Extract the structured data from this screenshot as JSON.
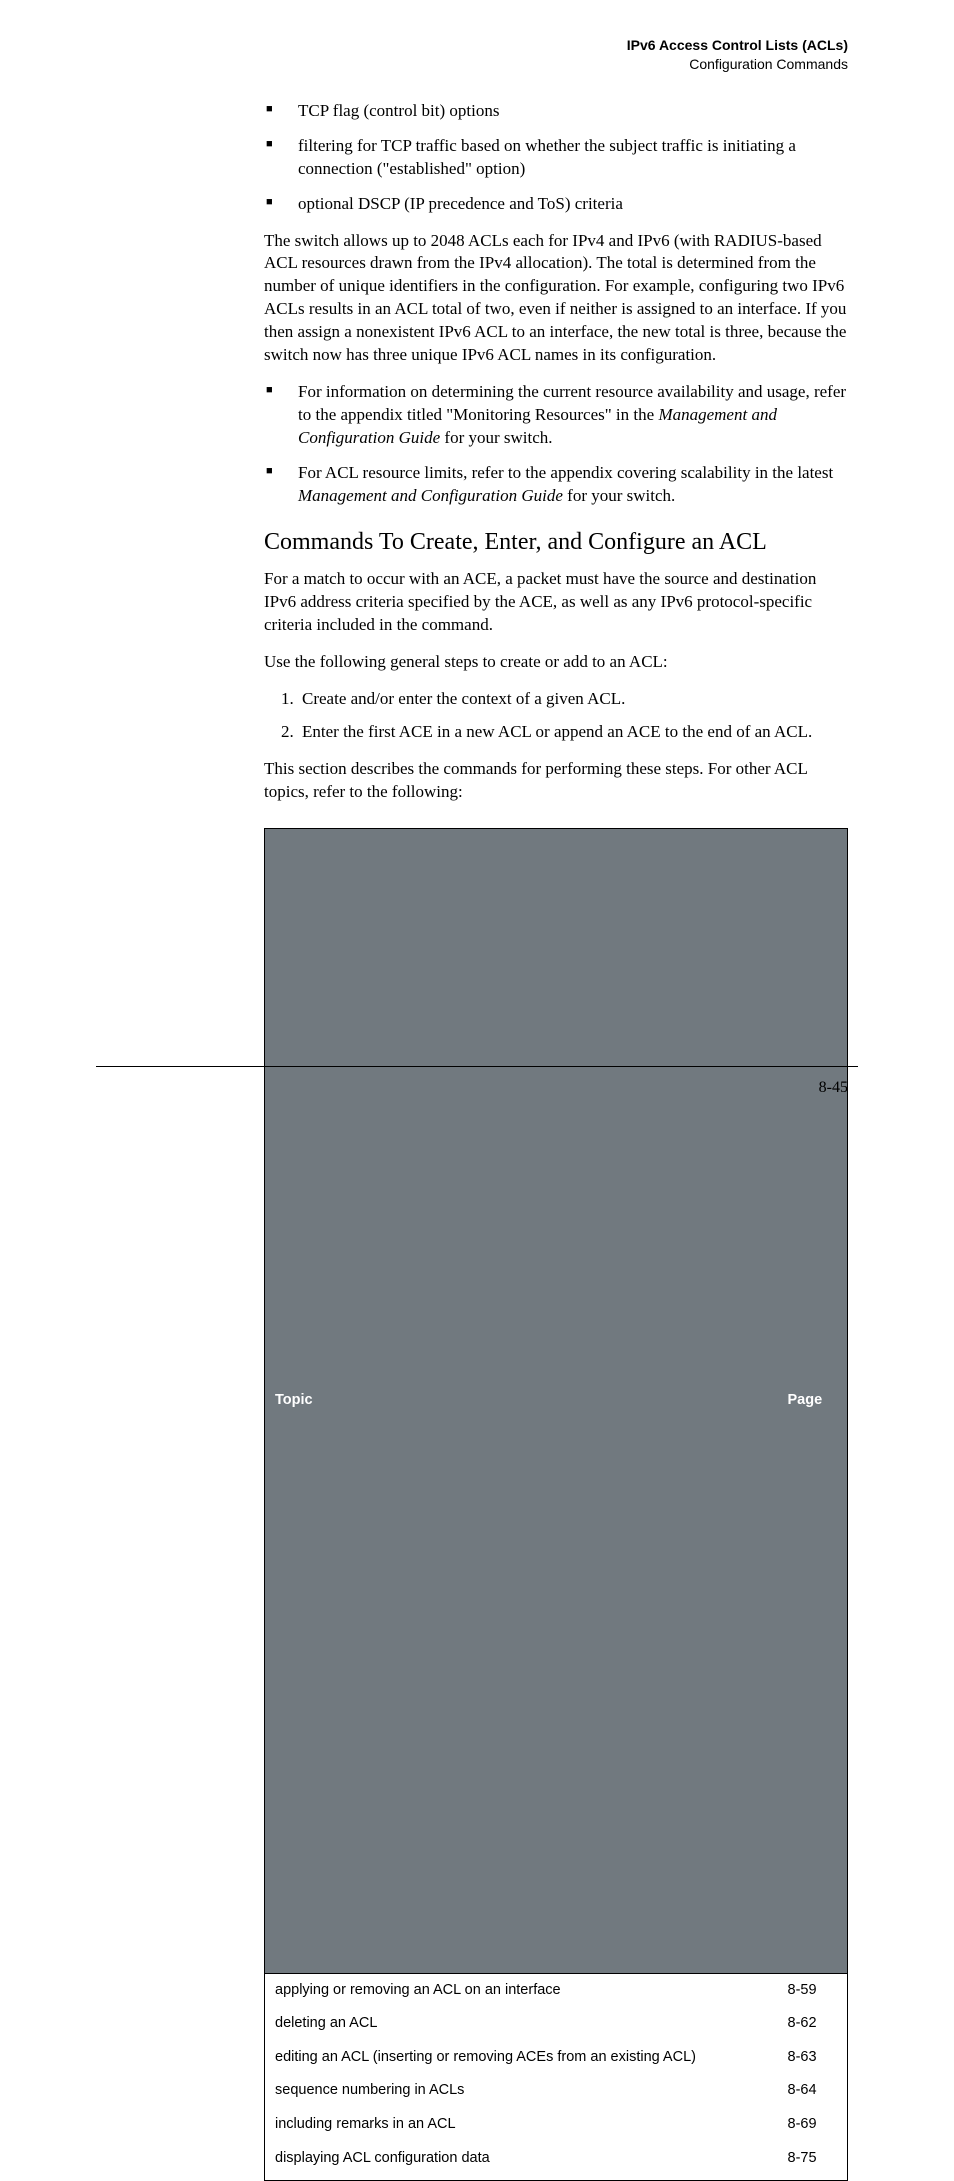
{
  "header": {
    "title": "IPv6 Access Control Lists (ACLs)",
    "subtitle": "Configuration Commands"
  },
  "bullets_top": [
    "TCP flag (control bit) options",
    "filtering for TCP traffic based on whether the subject traffic is initi­ating a connection (\"established\" option)",
    "optional DSCP (IP precedence and ToS) criteria"
  ],
  "para_switch": "The switch allows up to 2048 ACLs each for IPv4 and IPv6 (with RADIUS-based ACL resources drawn from the IPv4 allocation). The total is determined from the number of unique identifiers in the configuration. For example, configuring two IPv6 ACLs results in an ACL total of two, even if neither is assigned to an interface. If you then assign a nonexistent IPv6 ACL to an interface, the new total is three, because the switch now has three unique IPv6 ACL names in its configuration.",
  "bullets_info": {
    "b1_pre": "For information on determining the current resource availability and usage, refer to the appendix titled \"Monitoring Resources\" in the ",
    "b1_ital": "Management and Configuration Guide",
    "b1_post": " for your switch.",
    "b2_pre": "For ACL resource limits, refer to the appendix covering scalability in the latest ",
    "b2_ital": "Management and Configuration Guide",
    "b2_post": " for your switch."
  },
  "section_heading": "Commands To Create, Enter, and Configure an ACL",
  "para_match": "For a match to occur with an ACE, a packet must have the source and destination IPv6 address criteria specified by the ACE, as well as any IPv6 protocol-specific criteria included in the command.",
  "para_steps": "Use the following general steps to create or add to an ACL:",
  "steps": [
    "Create and/or enter the context of a given ACL.",
    "Enter the first ACE in a new ACL or append an ACE to the end of an ACL."
  ],
  "para_section_desc": "This section describes the commands for performing these steps. For other ACL topics, refer to the following:",
  "table": {
    "head_topic": "Topic",
    "head_page": "Page",
    "rows": [
      {
        "topic": "applying or removing an ACL on an interface",
        "page": "8-59"
      },
      {
        "topic": "deleting an ACL",
        "page": "8-62"
      },
      {
        "topic": "editing an ACL (inserting or removing ACEs from an existing ACL)",
        "page": "8-63"
      },
      {
        "topic": "sequence numbering in ACLs",
        "page": "8-64"
      },
      {
        "topic": "including remarks in an ACL",
        "page": "8-69"
      },
      {
        "topic": "displaying ACL configuration data",
        "page": "8-75"
      }
    ]
  },
  "page_number": "8-45"
}
